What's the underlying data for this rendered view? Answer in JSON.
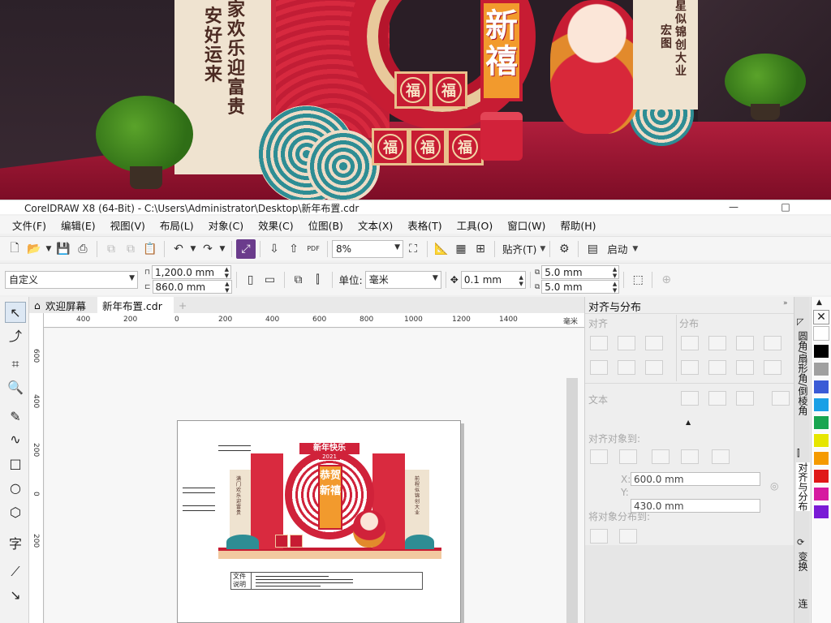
{
  "scene": {
    "left_panel_col1": "安好运来",
    "left_panel_col2": "家欢乐迎富贵",
    "sign_text": "新禧",
    "box_char": "福",
    "right_panel_col1": "宏图",
    "right_panel_col2": "星似锦创大业"
  },
  "window": {
    "title": "CorelDRAW X8 (64-Bit) - C:\\Users\\Administrator\\Desktop\\新年布置.cdr",
    "min": "—",
    "max": "□"
  },
  "menu": [
    "文件(F)",
    "编辑(E)",
    "视图(V)",
    "布局(L)",
    "对象(C)",
    "效果(C)",
    "位图(B)",
    "文本(X)",
    "表格(T)",
    "工具(O)",
    "窗口(W)",
    "帮助(H)"
  ],
  "toolbar": {
    "zoom": "8%",
    "snap_label": "贴齐(T)",
    "launch_label": "启动",
    "pdf_label": "PDF"
  },
  "propbar": {
    "preset": "自定义",
    "width": "1,200.0 mm",
    "height": "860.0 mm",
    "unit_label": "单位:",
    "unit": "毫米",
    "nudge": "0.1 mm",
    "dup_x": "5.0 mm",
    "dup_y": "5.0 mm"
  },
  "tabs": [
    "欢迎屏幕",
    "新年布置.cdr"
  ],
  "ruler": {
    "h_ticks": [
      "400",
      "200",
      "0",
      "200",
      "400",
      "600",
      "800",
      "1000",
      "1200",
      "1400"
    ],
    "h_unit": "毫米",
    "v_ticks": [
      "600",
      "400",
      "200",
      "0",
      "200"
    ]
  },
  "design": {
    "banner": "新年快乐",
    "year": "2021",
    "center": "恭贺新禧",
    "left_text": "满门欢乐迎富贵",
    "right_text": "前程似锦创大业",
    "file_label1": "文件",
    "file_label2": "说明"
  },
  "docker": {
    "title": "对齐与分布",
    "align": "对齐",
    "distribute": "分布",
    "text": "文本",
    "align_to": "对齐对象到:",
    "x_label": "X:",
    "y_label": "Y:",
    "x_value": "600.0 mm",
    "y_value": "430.0 mm",
    "distribute_to": "将对象分布到:"
  },
  "sidetabs": [
    "圆角/扇形角/倒棱角",
    "对齐与分布",
    "变换",
    "连"
  ],
  "palette": [
    "#ffffff",
    "#000000",
    "#a0a0a0",
    "#3a5bd6",
    "#1aa0e6",
    "#18a550",
    "#e6e600",
    "#f59a00",
    "#e01818",
    "#d61aa0",
    "#7a1ad6"
  ]
}
